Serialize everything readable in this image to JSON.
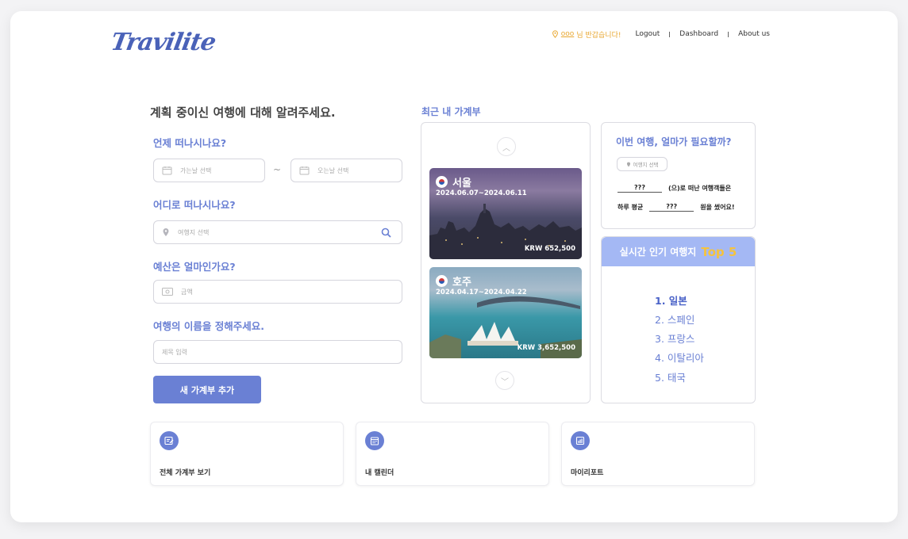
{
  "header": {
    "logo": "Travilite",
    "greeting_user": "ooo",
    "greeting_text": "님 반갑습니다!",
    "nav": [
      "Logout",
      "Dashboard",
      "About us"
    ]
  },
  "form": {
    "title": "계획 중이신 여행에 대해 알려주세요.",
    "when_label": "언제 떠나시나요?",
    "start_placeholder": "가는날 선택",
    "end_placeholder": "오는날 선택",
    "where_label": "어디로 떠나시나요?",
    "destination_placeholder": "여행지 선택",
    "budget_label": "예산은 얼마인가요?",
    "budget_placeholder": "금액",
    "name_label": "여행의 이름을 정해주세요.",
    "name_placeholder": "제목 입력",
    "submit": "새 가계부 추가"
  },
  "recent": {
    "title": "최근 내 가계부",
    "trips": [
      {
        "name": "서울",
        "dates": "2024.06.07~2024.06.11",
        "price": "KRW 652,500"
      },
      {
        "name": "호주",
        "dates": "2024.04.17~2024.04.22",
        "price": "KRW 3,652,500"
      }
    ]
  },
  "budget_panel": {
    "title": "이번 여행, 얼마가 필요할까?",
    "select": "여행지 선택",
    "blank1": "???",
    "line1_suffix": "(으)로 떠난 여행객들은",
    "line2_prefix": "하루 평균",
    "blank2": "???",
    "line2_suffix": "원을 썼어요!"
  },
  "top5": {
    "title": "실시간 인기 여행지",
    "title_big": "Top 5",
    "items": [
      "1. 일본",
      "2. 스페인",
      "3. 프랑스",
      "4. 이탈리아",
      "5. 태국"
    ]
  },
  "shortcuts": [
    {
      "label": "전체 가계부 보기",
      "icon": "edit-note-icon"
    },
    {
      "label": "내 캘린더",
      "icon": "calendar-icon"
    },
    {
      "label": "마이리포트",
      "icon": "report-icon"
    }
  ],
  "colors": {
    "accent": "#6a80d4",
    "highlight": "#e8a730",
    "top5_head": "#a4b8f4",
    "top5_gold": "#f5c33e"
  }
}
